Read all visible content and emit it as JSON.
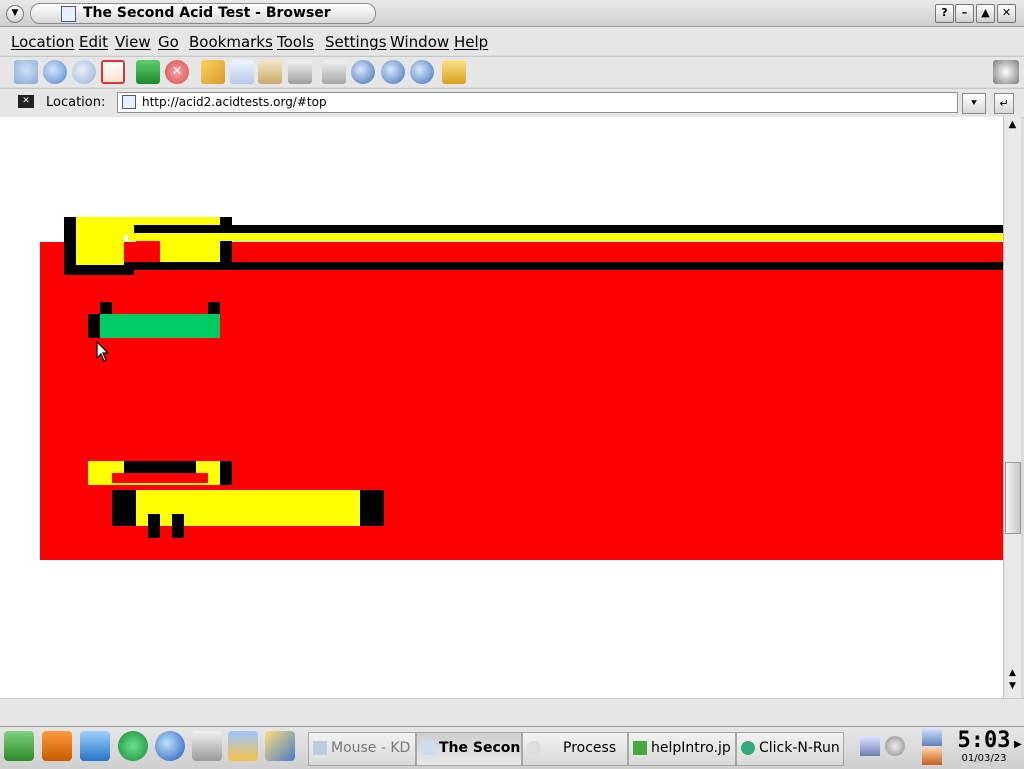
{
  "window": {
    "title": "The Second Acid Test - Browser"
  },
  "menu": [
    "Location",
    "Edit",
    "View",
    "Go",
    "Bookmarks",
    "Tools",
    "Settings",
    "Window",
    "Help"
  ],
  "toolbar": {
    "icons": [
      "home-icon",
      "back-icon",
      "forward-icon",
      "home-icon",
      "reload-icon",
      "stop-icon",
      "cut-icon",
      "copy-icon",
      "paste-icon",
      "print-icon",
      "print-frame-icon",
      "zoom-in-icon",
      "zoom-out-icon",
      "zoom-icon",
      "security-lock-icon"
    ]
  },
  "location": {
    "label": "Location:",
    "url": "http://acid2.acidtests.org/#top"
  },
  "taskbar": {
    "tasks": [
      "Mouse - KD",
      "The Secon",
      "Process",
      "helpIntro.jp",
      "Click-N-Run"
    ],
    "clock": {
      "time": "5:03",
      "date": "01/03/23"
    }
  },
  "colors": {
    "red": "#ff0000",
    "yellow": "#ffff00",
    "green": "#00cc66"
  }
}
